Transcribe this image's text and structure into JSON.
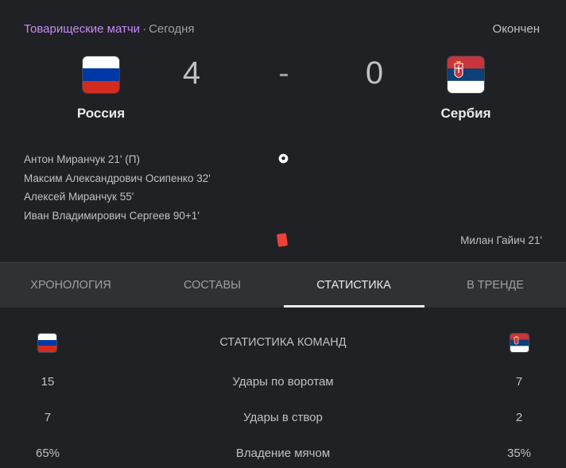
{
  "header": {
    "competition": "Товарищеские матчи",
    "separator": "·",
    "date": "Сегодня",
    "status": "Окончен"
  },
  "home": {
    "name": "Россия",
    "score": "4",
    "flag_colors": [
      "#ffffff",
      "#0039a6",
      "#d52b1e"
    ]
  },
  "away": {
    "name": "Сербия",
    "score": "0",
    "flag_colors": [
      "#c6363c",
      "#0c4076",
      "#ffffff"
    ]
  },
  "score_separator": "-",
  "scorers": [
    "Антон Миранчук 21' (П)",
    "Максим Александрович Осипенко 32'",
    "Алексей Миранчук 55'",
    "Иван Владимирович Сергеев 90+1'"
  ],
  "away_red_card": "Милан Гайич 21'",
  "tabs": [
    "ХРОНОЛОГИЯ",
    "СОСТАВЫ",
    "СТАТИСТИКА",
    "В ТРЕНДЕ"
  ],
  "active_tab": "СТАТИСТИКА",
  "stats": {
    "title": "СТАТИСТИКА КОМАНД",
    "rows": [
      {
        "home": "15",
        "label": "Удары по воротам",
        "away": "7"
      },
      {
        "home": "7",
        "label": "Удары в створ",
        "away": "2"
      },
      {
        "home": "65%",
        "label": "Владение мячом",
        "away": "35%"
      }
    ]
  },
  "icons": {
    "goal": "soccer-ball-icon",
    "card": "red-card-icon"
  }
}
